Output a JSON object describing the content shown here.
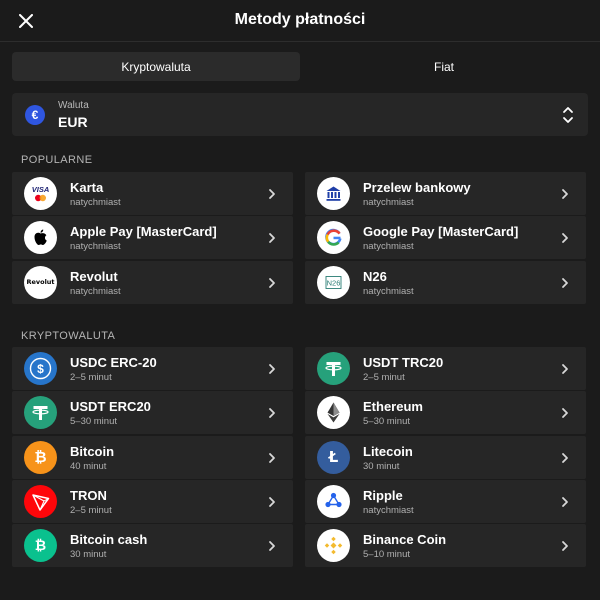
{
  "header": {
    "title": "Metody płatności",
    "close_icon": "close-icon"
  },
  "tabs": [
    {
      "label": "Kryptowaluta",
      "active": true
    },
    {
      "label": "Fiat",
      "active": false
    }
  ],
  "currency": {
    "label": "Waluta",
    "value": "EUR",
    "badge": "€",
    "icon": "euro-icon"
  },
  "popular": {
    "title": "POPULARNE",
    "left": [
      {
        "name": "Karta",
        "sub": "natychmiast",
        "icon": "visa-mastercard-icon"
      },
      {
        "name": "Apple Pay [MasterCard]",
        "sub": "natychmiast",
        "icon": "apple-icon"
      },
      {
        "name": "Revolut",
        "sub": "natychmiast",
        "icon": "revolut-icon",
        "logo_text": "Revolut"
      }
    ],
    "right": [
      {
        "name": "Przelew bankowy",
        "sub": "natychmiast",
        "icon": "bank-icon"
      },
      {
        "name": "Google Pay [MasterCard]",
        "sub": "natychmiast",
        "icon": "google-icon"
      },
      {
        "name": "N26",
        "sub": "natychmiast",
        "icon": "n26-icon",
        "logo_text": "N26"
      }
    ]
  },
  "crypto": {
    "title": "KRYPTOWALUTA",
    "left": [
      {
        "name": "USDC ERC-20",
        "sub": "2–5 minut",
        "icon": "usdc-icon"
      },
      {
        "name": "USDT ERC20",
        "sub": "5–30 minut",
        "icon": "usdt-icon"
      },
      {
        "name": "Bitcoin",
        "sub": "40 minut",
        "icon": "bitcoin-icon"
      },
      {
        "name": "TRON",
        "sub": "2–5 minut",
        "icon": "tron-icon"
      },
      {
        "name": "Bitcoin cash",
        "sub": "30 minut",
        "icon": "bitcoin-cash-icon"
      }
    ],
    "right": [
      {
        "name": "USDT TRC20",
        "sub": "2–5 minut",
        "icon": "usdt-icon"
      },
      {
        "name": "Ethereum",
        "sub": "5–30 minut",
        "icon": "ethereum-icon"
      },
      {
        "name": "Litecoin",
        "sub": "30 minut",
        "icon": "litecoin-icon"
      },
      {
        "name": "Ripple",
        "sub": "natychmiast",
        "icon": "ripple-icon"
      },
      {
        "name": "Binance Coin",
        "sub": "5–10 minut",
        "icon": "binance-icon"
      }
    ]
  },
  "colors": {
    "background": "#1b1b1b",
    "card": "#262626",
    "active_tab": "#2b2b2b",
    "euro_badge": "#2f56e0",
    "muted_text": "#b0b0b0"
  }
}
